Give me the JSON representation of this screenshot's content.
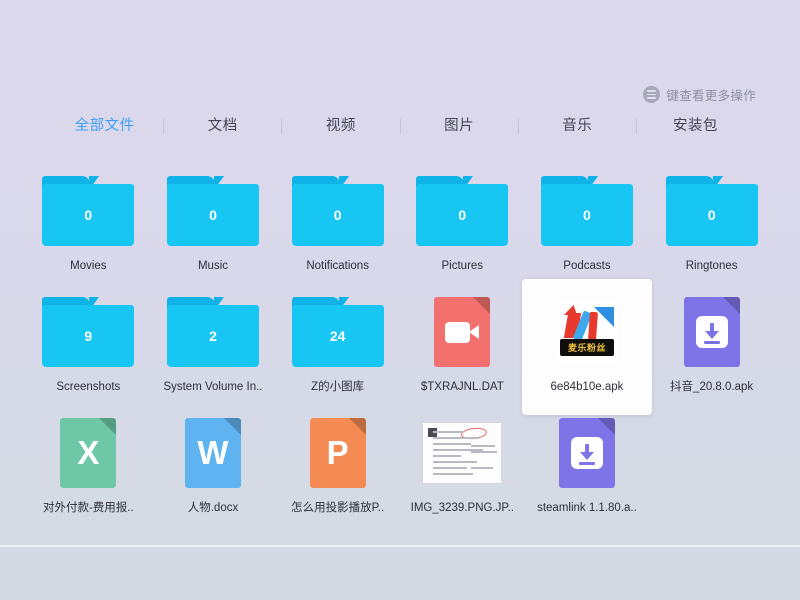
{
  "header": {
    "more_actions_label": "键查看更多操作",
    "more_actions_icon": "circle-menu-icon"
  },
  "tabs": [
    {
      "label": "全部文件",
      "active": true
    },
    {
      "label": "文档",
      "active": false
    },
    {
      "label": "视频",
      "active": false
    },
    {
      "label": "图片",
      "active": false
    },
    {
      "label": "音乐",
      "active": false
    },
    {
      "label": "安装包",
      "active": false
    }
  ],
  "colors": {
    "accent": "#3da0f5",
    "folder": "#17c6f3",
    "folder_tab": "#0fb3e8",
    "apk": "#7e74e8",
    "excel": "#6ec8a8",
    "word": "#5fb3f0",
    "ppt": "#f58b54",
    "video": "#f2716e",
    "background_top": "#dbd8ec",
    "background_bottom": "#d3dae3"
  },
  "items": [
    {
      "name": "Movies",
      "type": "folder",
      "count": "0",
      "icon": "folder-icon",
      "selected": false
    },
    {
      "name": "Music",
      "type": "folder",
      "count": "0",
      "icon": "folder-icon",
      "selected": false
    },
    {
      "name": "Notifications",
      "type": "folder",
      "count": "0",
      "icon": "folder-icon",
      "selected": false
    },
    {
      "name": "Pictures",
      "type": "folder",
      "count": "0",
      "icon": "folder-icon",
      "selected": false
    },
    {
      "name": "Podcasts",
      "type": "folder",
      "count": "0",
      "icon": "folder-icon",
      "selected": false
    },
    {
      "name": "Ringtones",
      "type": "folder",
      "count": "0",
      "icon": "folder-icon",
      "selected": false
    },
    {
      "name": "Screenshots",
      "type": "folder",
      "count": "9",
      "icon": "folder-icon",
      "selected": false
    },
    {
      "name": "System Volume In..",
      "type": "folder",
      "count": "2",
      "icon": "folder-icon",
      "selected": false
    },
    {
      "name": "Z的小图库",
      "type": "folder",
      "count": "24",
      "icon": "folder-icon",
      "selected": false
    },
    {
      "name": "$TXRAJNL.DAT",
      "type": "video",
      "count": "",
      "icon": "video-file-icon",
      "selected": false
    },
    {
      "name": "6e84b10e.apk",
      "type": "app",
      "count": "",
      "icon": "music-app-icon",
      "selected": true,
      "app_banner": "麦乐粉丝"
    },
    {
      "name": "抖音_20.8.0.apk",
      "type": "apk",
      "count": "",
      "icon": "apk-file-icon",
      "selected": false
    },
    {
      "name": "对外付款-费用报..",
      "type": "excel",
      "count": "",
      "icon": "excel-file-icon",
      "selected": false,
      "glyph": "X"
    },
    {
      "name": "人物.docx",
      "type": "word",
      "count": "",
      "icon": "word-file-icon",
      "selected": false,
      "glyph": "W"
    },
    {
      "name": "怎么用投影播放P..",
      "type": "ppt",
      "count": "",
      "icon": "powerpoint-file-icon",
      "selected": false,
      "glyph": "P"
    },
    {
      "name": "IMG_3239.PNG.JP..",
      "type": "image",
      "count": "",
      "icon": "image-thumbnail-icon",
      "selected": false
    },
    {
      "name": "steamlink 1.1.80.a..",
      "type": "apk",
      "count": "",
      "icon": "apk-file-icon",
      "selected": false
    }
  ]
}
